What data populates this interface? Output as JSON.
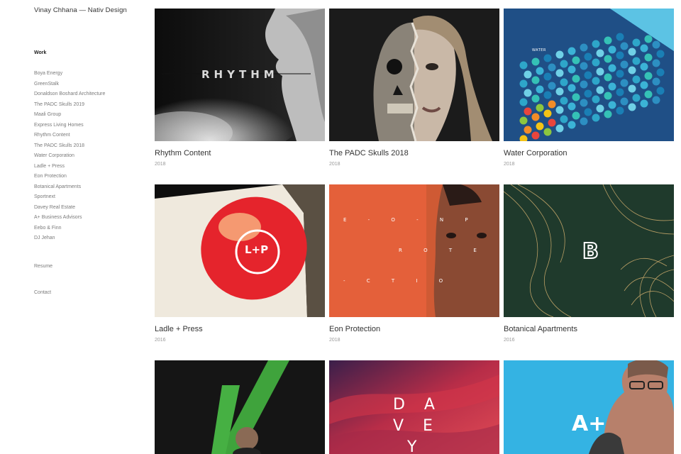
{
  "site": {
    "title": "Vinay Chhana — Nativ Design"
  },
  "nav": {
    "heading": "Work",
    "items": [
      "Boya Energy",
      "GreenStalk",
      "Donaldson Boshard Architecture",
      "The PADC Skulls 2019",
      "Maali Group",
      "Express Living Homes",
      "Rhythm Content",
      "The PADC Skulls 2018",
      "Water Corporation",
      "Ladle + Press",
      "Eon Protection",
      "Botanical Apartments",
      "Sportnext",
      "Davey Real Estate",
      "A+ Business Advisors",
      "Eebo & Finn",
      "DJ Jehan"
    ],
    "resume": "Resume",
    "contact": "Contact"
  },
  "projects": [
    {
      "title": "Rhythm Content",
      "year": "2018",
      "image": "rhythm-artwork",
      "art_text": "RHYTHM"
    },
    {
      "title": "The PADC Skulls 2018",
      "year": "2018",
      "image": "skull-portrait"
    },
    {
      "title": "Water Corporation",
      "year": "2018",
      "image": "water-dots-brochure",
      "art_text": "WATER"
    },
    {
      "title": "Ladle + Press",
      "year": "2016",
      "image": "lit-sign",
      "art_text": "L+P"
    },
    {
      "title": "Eon Protection",
      "year": "2018",
      "image": "eon-portrait",
      "art_lines": [
        "E - O - N P",
        "R O T E",
        "- C T I O"
      ]
    },
    {
      "title": "Botanical Apartments",
      "year": "2016",
      "image": "botanical-line-art"
    },
    {
      "title": "",
      "year": "",
      "image": "sportnext-green-stripe"
    },
    {
      "title": "",
      "year": "",
      "image": "davey-red-texture",
      "art_lines": [
        "D A",
        "V E",
        "Y"
      ]
    },
    {
      "title": "",
      "year": "",
      "image": "aplus-portrait",
      "art_text": "A+"
    }
  ],
  "colors": {
    "eon_orange": "#e4603a",
    "botanical_green": "#1f3a2c",
    "water_blue": "#3aaed6",
    "davey_red": "#d4364a",
    "aplus_blue": "#34b3e3",
    "sport_green": "#3fa33c"
  }
}
